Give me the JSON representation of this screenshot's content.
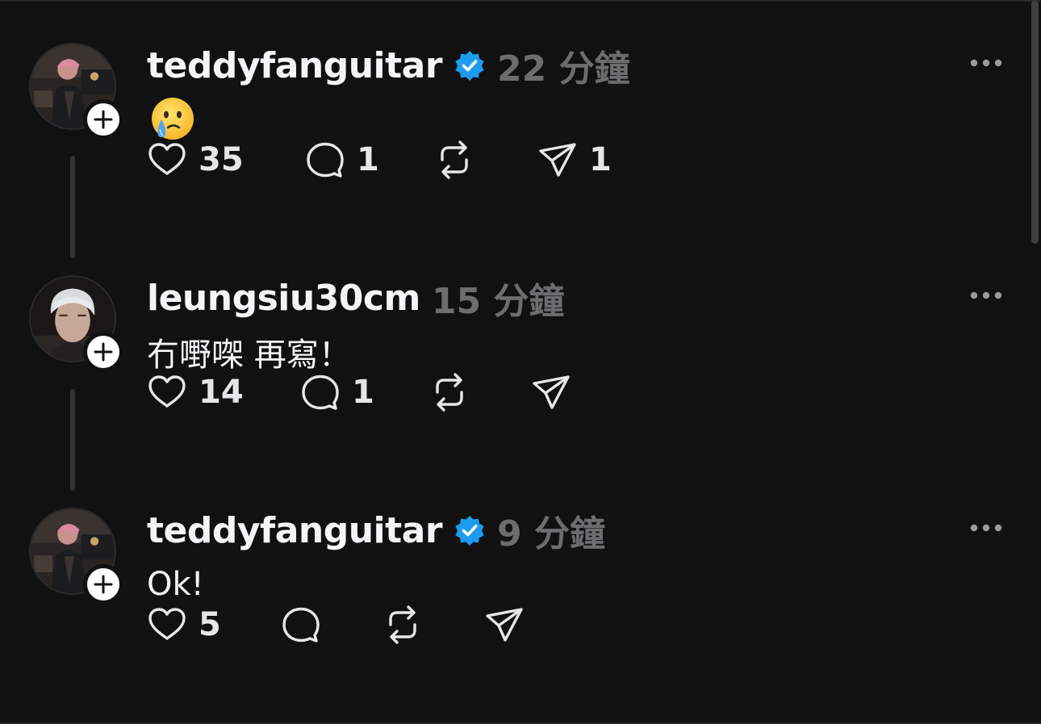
{
  "colors": {
    "background": "#111112",
    "text": "#f3f5f7",
    "muted": "#6d6d70",
    "verified": "#1d9bf0",
    "thread_line": "#333336"
  },
  "icons": {
    "like": "heart-icon",
    "reply": "comment-bubble-icon",
    "repost": "repost-arrows-icon",
    "share": "send-paper-plane-icon",
    "more": "ellipsis-icon",
    "follow": "plus-icon",
    "verified": "verified-badge-icon"
  },
  "posts": [
    {
      "username": "teddyfanguitar",
      "verified": true,
      "time": "22 分鐘",
      "content_type": "emoji",
      "emoji": "face-holding-back-tears",
      "text": "",
      "likes": "35",
      "replies": "1",
      "reposts": "",
      "shares": "1"
    },
    {
      "username": "leungsiu30cm",
      "verified": false,
      "time": "15 分鐘",
      "content_type": "text",
      "emoji": "",
      "text": "冇嘢㗎 再寫！",
      "likes": "14",
      "replies": "1",
      "reposts": "",
      "shares": ""
    },
    {
      "username": "teddyfanguitar",
      "verified": true,
      "time": "9 分鐘",
      "content_type": "text",
      "emoji": "",
      "text": "Ok!",
      "likes": "5",
      "replies": "",
      "reposts": "",
      "shares": ""
    }
  ]
}
